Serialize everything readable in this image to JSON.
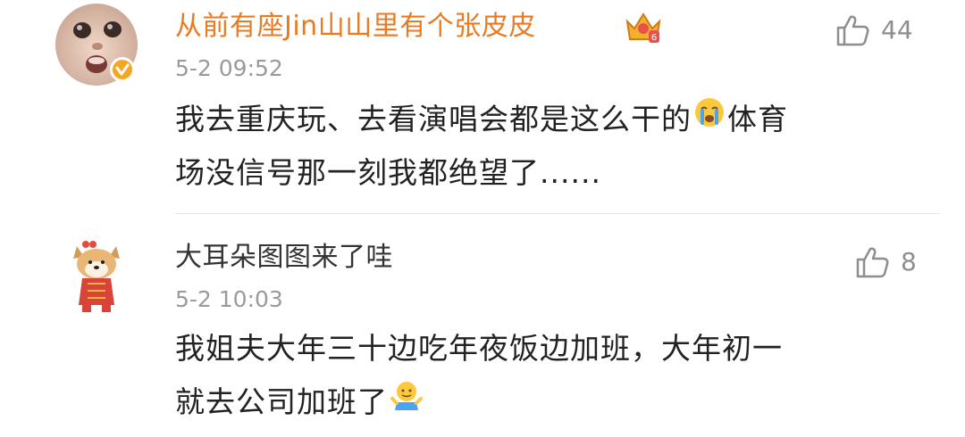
{
  "comments": [
    {
      "username": "从前有座Jin山山里有个张皮皮",
      "username_color": "#ea7a22",
      "vip_icon": "crown-badge-icon",
      "verified_icon": "verified-badge-icon",
      "timestamp": "5-2 09:52",
      "likes": "44",
      "text_lines": [
        {
          "before": "我去重庆玩、去看演唱会都是这么干的",
          "emoji": "crying-emoji-icon",
          "after": "体育"
        },
        {
          "text": "场没信号那一刻我都绝望了......"
        }
      ]
    },
    {
      "username": "大耳朵图图来了哇",
      "username_color": "#333333",
      "avatar_icon": "cartoon-dog-avatar",
      "timestamp": "5-2 10:03",
      "likes": "8",
      "text_lines": [
        {
          "text": "我姐夫大年三十边吃年夜饭边加班，大年初一"
        },
        {
          "before": "就去公司加班了",
          "emoji": "shrug-emoji-icon"
        }
      ]
    }
  ],
  "colors": {
    "vip_orange": "#ea7a22",
    "timestamp_gray": "#9a9a9a",
    "like_gray": "#8e8e8e",
    "badge_yellow": "#f5a623"
  }
}
